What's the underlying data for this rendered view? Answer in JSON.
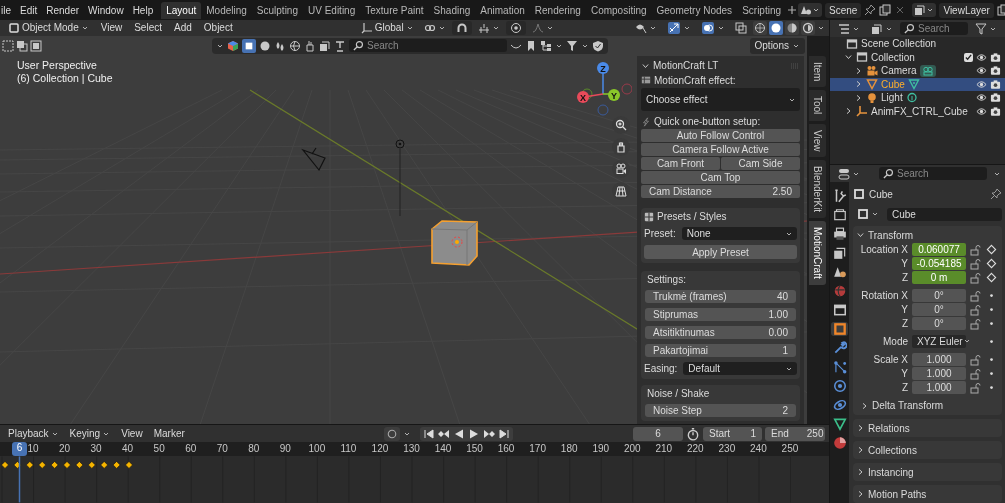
{
  "menu": [
    "ile",
    "Edit",
    "Render",
    "Window",
    "Help"
  ],
  "workspaces": [
    {
      "label": "Layout",
      "selected": true
    },
    {
      "label": "Modeling",
      "selected": false
    },
    {
      "label": "Sculpting",
      "selected": false
    },
    {
      "label": "UV Editing",
      "selected": false
    },
    {
      "label": "Texture Paint",
      "selected": false
    },
    {
      "label": "Shading",
      "selected": false
    },
    {
      "label": "Animation",
      "selected": false
    },
    {
      "label": "Rendering",
      "selected": false
    },
    {
      "label": "Compositing",
      "selected": false
    },
    {
      "label": "Geometry Nodes",
      "selected": false
    },
    {
      "label": "Scripting",
      "selected": false
    }
  ],
  "scene": "Scene",
  "view_layer": "ViewLayer",
  "header": {
    "mode": "Object Mode",
    "menus": [
      "View",
      "Select",
      "Add",
      "Object"
    ],
    "orientation": "Global",
    "shading": [
      {
        "kind": "wireframe",
        "selected": false
      },
      {
        "kind": "solid",
        "selected": true
      },
      {
        "kind": "material",
        "selected": false
      },
      {
        "kind": "rendered",
        "selected": false
      }
    ]
  },
  "viewport": {
    "toolbar_search": "Search",
    "options": "Options",
    "overlay": [
      "User Perspective",
      "(6) Collection | Cube"
    ],
    "gizmo": [
      "X",
      "Y",
      "Z"
    ]
  },
  "sidebar": {
    "title": "MotionCraft LT",
    "expanded": true,
    "effect_label": "MotionCraft effect:",
    "effect": "Choose effect",
    "quick_label": "Quick one-button setup:",
    "quick_rows": [
      {
        "buttons": [
          "Auto Follow Control"
        ]
      },
      {
        "buttons": [
          "Camera Follow Active"
        ]
      },
      {
        "buttons": [
          "Cam Front",
          "Cam Side"
        ]
      },
      {
        "buttons": [
          "Cam Top"
        ]
      }
    ],
    "distance": {
      "label": "Cam Distance",
      "value": "2.50"
    },
    "presets": {
      "title": "Presets / Styles",
      "preset_label": "Preset:",
      "preset": "None",
      "apply": "Apply Preset"
    },
    "settings": {
      "title": "Settings:",
      "fields": [
        {
          "label": "Trukmė (frames)",
          "value": "40"
        },
        {
          "label": "Stiprumas",
          "value": "1.00"
        },
        {
          "label": "Atsitiktinumas",
          "value": "0.00"
        },
        {
          "label": "Pakartojimai",
          "value": "1"
        }
      ],
      "easing_label": "Easing:",
      "easing": "Default"
    },
    "noise": {
      "title": "Noise / Shake",
      "fields": [
        {
          "label": "Noise Step",
          "value": "2"
        }
      ]
    }
  },
  "sidebar_tabs": [
    {
      "label": "Item",
      "selected": false
    },
    {
      "label": "Tool",
      "selected": false
    },
    {
      "label": "View",
      "selected": false
    },
    {
      "label": "BlenderKit",
      "selected": false
    },
    {
      "label": "MotionCraft",
      "selected": true
    }
  ],
  "timeline": {
    "menus": [
      {
        "label": "Playback",
        "dropdown": true
      },
      {
        "label": "Keying",
        "dropdown": true
      },
      {
        "label": "View",
        "dropdown": false
      },
      {
        "label": "Marker",
        "dropdown": false
      }
    ],
    "auto_keying": false,
    "current_frame": "6",
    "start_label": "Start",
    "start": "1",
    "end_label": "End",
    "end": "250",
    "playhead": "6",
    "ticks": [
      "10",
      "20",
      "30",
      "40",
      "50",
      "60",
      "70",
      "80",
      "90",
      "100",
      "110",
      "120",
      "130",
      "140",
      "150",
      "160",
      "170",
      "180",
      "190",
      "200",
      "210",
      "220",
      "230",
      "240",
      "250"
    ]
  },
  "outliner": {
    "search": "Search",
    "tree": [
      {
        "label": "Scene Collection",
        "kind": "scene",
        "selected": false,
        "children": [
          {
            "label": "Collection",
            "kind": "collection",
            "expanded": true,
            "checked": true,
            "selected": false,
            "children": [
              {
                "label": "Camera",
                "kind": "camera",
                "expanded": false,
                "selected": false
              },
              {
                "label": "Cube",
                "kind": "mesh",
                "expanded": false,
                "selected": true
              },
              {
                "label": "Light",
                "kind": "light",
                "expanded": false,
                "selected": false
              }
            ]
          },
          {
            "label": "AnimFX_CTRL_Cube",
            "kind": "empty",
            "expanded": false,
            "selected": false
          }
        ]
      }
    ]
  },
  "properties": {
    "search": "Search",
    "object_name": "Cube",
    "data_name": "Cube",
    "tabs": [
      {
        "kind": "tool",
        "selected": false
      },
      {
        "kind": "render",
        "selected": false
      },
      {
        "kind": "output",
        "selected": false
      },
      {
        "kind": "view_layer",
        "selected": false
      },
      {
        "kind": "scene",
        "selected": false
      },
      {
        "kind": "world",
        "selected": false
      },
      {
        "kind": "collection",
        "selected": false
      },
      {
        "kind": "object",
        "selected": true
      },
      {
        "kind": "modifier",
        "selected": false
      },
      {
        "kind": "particles",
        "selected": false
      },
      {
        "kind": "physics",
        "selected": false
      },
      {
        "kind": "constraint",
        "selected": false
      },
      {
        "kind": "data",
        "selected": false
      },
      {
        "kind": "material",
        "selected": false
      }
    ],
    "transform": {
      "title": "Transform",
      "expanded": true,
      "rows": [
        {
          "label": "Location X",
          "value": "0.060077",
          "kind": "number",
          "keyed": true
        },
        {
          "label": "Y",
          "value": "-0.054185",
          "kind": "number",
          "keyed": true
        },
        {
          "label": "Z",
          "value": "0 m",
          "kind": "number",
          "keyed": true
        },
        {
          "label": "Rotation X",
          "value": "0°",
          "kind": "number",
          "keyed": false
        },
        {
          "label": "Y",
          "value": "0°",
          "kind": "number",
          "keyed": false
        },
        {
          "label": "Z",
          "value": "0°",
          "kind": "number",
          "keyed": false
        },
        {
          "label": "Mode",
          "value": "XYZ Euler",
          "kind": "dropdown",
          "keyed": false
        },
        {
          "label": "Scale X",
          "value": "1.000",
          "kind": "number",
          "keyed": false
        },
        {
          "label": "Y",
          "value": "1.000",
          "kind": "number",
          "keyed": false
        },
        {
          "label": "Z",
          "value": "1.000",
          "kind": "number",
          "keyed": false
        }
      ],
      "delta": {
        "title": "Delta Transform",
        "expanded": false
      }
    },
    "panels": [
      {
        "title": "Relations",
        "expanded": false
      },
      {
        "title": "Collections",
        "expanded": false
      },
      {
        "title": "Instancing",
        "expanded": false
      },
      {
        "title": "Motion Paths",
        "expanded": false
      }
    ]
  }
}
